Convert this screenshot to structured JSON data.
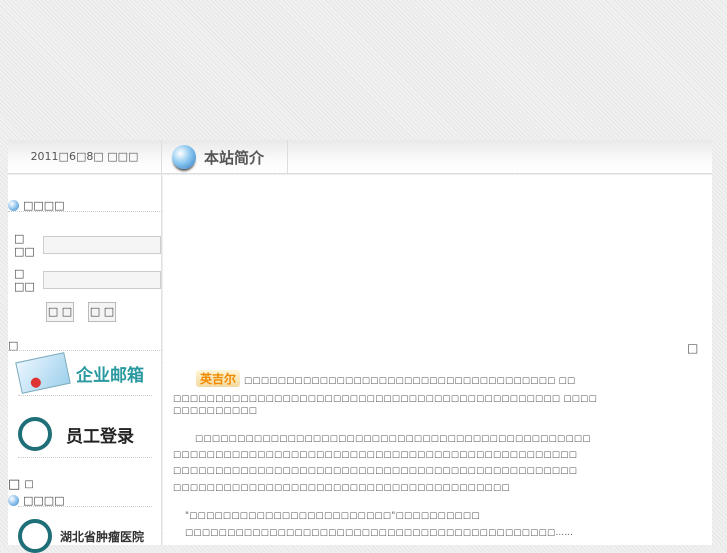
{
  "header": {
    "date": "2011□6□8□ □□□",
    "tab_title": "本站简介"
  },
  "login": {
    "section_title": "□□□□",
    "user_label": "□ □□",
    "pass_label": "□ □□",
    "user_value": "",
    "pass_value": "",
    "submit": "□ □",
    "reset": "□ □"
  },
  "left": {
    "stray1": "□",
    "email_label": "企业邮箱",
    "staff_label": "员工登录",
    "stray2": "□",
    "stray3": "□",
    "links_title": "□□□□",
    "hospital_label": "湖北省肿瘤医院"
  },
  "main": {
    "stray": "□",
    "logo_text": "英吉尔",
    "p1": [
      "□□□□□□□□□□□□□□□□□□□□□□□□□□□□□□□□□□□□□ □□",
      "□□□□□□□□□□□□□□□□□□□□□□□□□□□□□□□□□□□□□□□□□□□□□□ □□□□",
      "□□□□□□□□□□"
    ],
    "p2": [
      "□□□□□□□□□□□□□□□□□□□□□□□□□□□□□□□□□□□□□□□□□□□□□□□",
      "□□□□□□□□□□□□□□□□□□□□□□□□□□□□□□□□□□□□□□□□□□□□□□□□",
      "□□□□□□□□□□□□□□□□□□□□□□□□□□□□□□□□□□□□□□□□□□□□□□□□",
      "□□□□□□□□□□□□□□□□□□□□□□□□□□□□□□□□□□□□□□□□"
    ],
    "p3": [
      "\"□□□□□□□□□□□□□□□□□□□□□□□□\"□□□□□□□□□□",
      "□□□□□□□□□□□□□□□□□□□□□□□□□□□□□□□□□□□□□□□□□□□□……"
    ]
  }
}
